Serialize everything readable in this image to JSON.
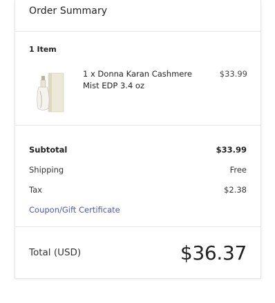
{
  "summary": {
    "title": "Order Summary",
    "item_count": "1 Item"
  },
  "product": {
    "name": "1 x Donna Karan Cashmere Mist EDP 3.4 oz",
    "price": "$33.99",
    "image": "perfume-bottle-image"
  },
  "totals": {
    "subtotal_label": "Subtotal",
    "subtotal_value": "$33.99",
    "shipping_label": "Shipping",
    "shipping_value": "Free",
    "tax_label": "Tax",
    "tax_value": "$2.38",
    "coupon_link": "Coupon/Gift Certificate"
  },
  "grand_total": {
    "label": "Total (USD)",
    "value": "$36.37"
  },
  "colors": {
    "link": "#4a57c8",
    "divider": "#e6e6e6"
  }
}
